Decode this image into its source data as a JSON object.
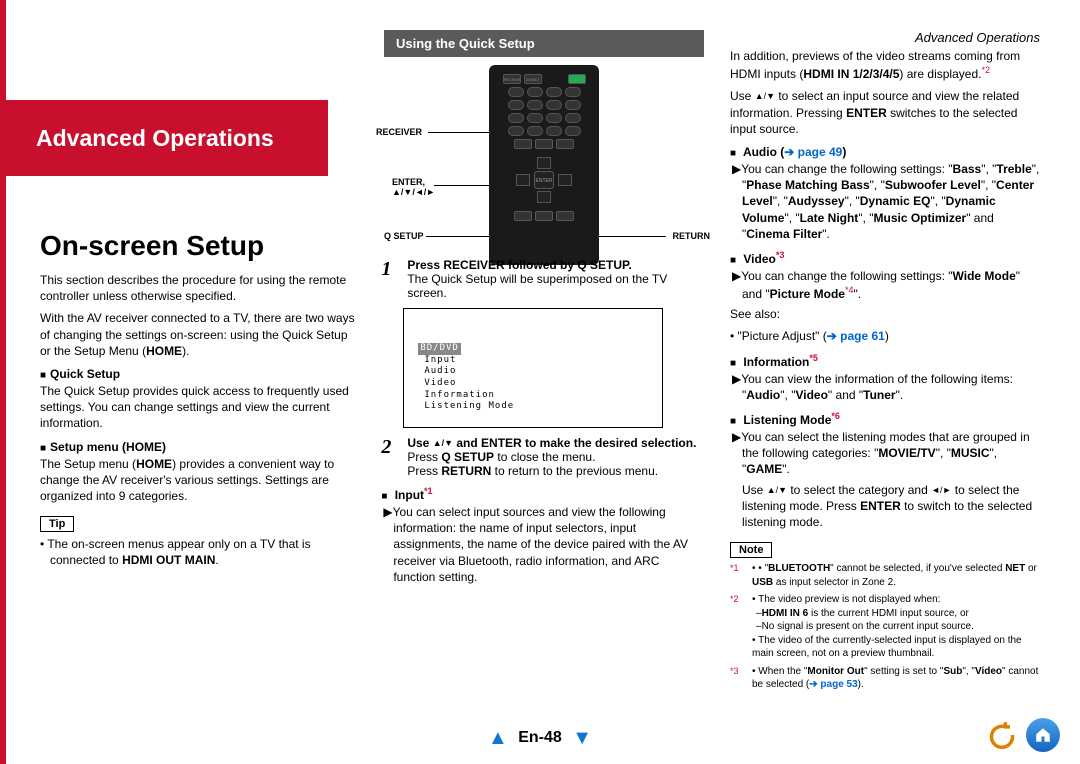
{
  "headerRight": "Advanced Operations",
  "redBarTitle": "Advanced Operations",
  "col1": {
    "title": "On-screen Setup",
    "intro1": "This section describes the procedure for using the remote controller unless otherwise specified.",
    "intro2": "With the AV receiver connected to a TV, there are two ways of changing the settings on-screen: using the Quick Setup or the Setup Menu (",
    "intro2home": "HOME",
    "intro2end": ").",
    "qsHead": "Quick Setup",
    "qsText": "The Quick Setup provides quick access to frequently used settings. You can change settings and view the current information.",
    "smHead": "Setup menu (HOME)",
    "smText1": "The Setup menu (",
    "smHome": "HOME",
    "smText2": ") provides a convenient way to change the AV receiver's various settings. Settings are organized into 9 categories.",
    "tipLabel": "Tip",
    "tip1a": "The on-screen menus appear only on a TV that is connected to ",
    "tip1b": "HDMI OUT MAIN",
    "tip1c": "."
  },
  "col2": {
    "barTitle": "Using the Quick Setup",
    "labels": {
      "receiver": "RECEIVER",
      "enter": "ENTER,",
      "arrows": "▲/▼/◄/►",
      "qsetup": "Q SETUP",
      "return": "RETURN"
    },
    "step1Head": "Press RECEIVER followed by Q SETUP.",
    "step1Body": "The Quick Setup will be superimposed on the TV screen.",
    "osd": {
      "title": "BD/DVD",
      "items": [
        "Input",
        "Audio",
        "Video",
        "Information",
        "Listening Mode"
      ]
    },
    "step2Head1": "Use ",
    "step2Head2": " and ENTER to make the desired selection.",
    "udSymbol": "▲/▼",
    "step2l1a": "Press ",
    "step2l1b": "Q SETUP",
    "step2l1c": " to close the menu.",
    "step2l2a": "Press ",
    "step2l2b": "RETURN",
    "step2l2c": " to return to the previous menu.",
    "inputHead": "Input",
    "inputSup": "*1",
    "inputBody": "You can select input sources and view the following information: the name of input selectors, input assignments, the name of the device paired with the AV receiver via Bluetooth, radio information, and ARC function setting."
  },
  "col3": {
    "topPara1a": "In addition, previews of the video streams coming from HDMI inputs (",
    "topPara1b": "HDMI IN 1/2/3/4/5",
    "topPara1c": ") are displayed.",
    "topSup": "*2",
    "topPara2a": "Use ",
    "topPara2b": " to select an input source and view the related information. Pressing ",
    "topPara2c": "ENTER",
    "topPara2d": " switches to the selected input source.",
    "audioHead": "Audio (",
    "audioLink": "➔ page 49",
    "audioHeadEnd": ")",
    "audioBody1": "You can change the following settings: \"",
    "audioBass": "Bass",
    "audioTre": "Treble",
    "audioPMB": "Phase Matching Bass",
    "audioSub": "Subwoofer Level",
    "audioCen": "Center Level",
    "audioAud": "Audyssey",
    "audioDEQ": "Dynamic EQ",
    "audioDV": "Dynamic Volume",
    "audioLN": "Late Night",
    "audioMO": "Music Optimizer",
    "audioCF": "Cinema Filter",
    "videoHead": "Video",
    "videoSup": "*3",
    "videoBody1": "You can change the following settings: \"",
    "videoWM": "Wide Mode",
    "videoPM": "Picture Mode",
    "videoPMSup": "*4",
    "seeAlso": "See also:",
    "seeAlsoItem": "\"Picture Adjust\" (",
    "seeAlsoLink": "➔ page 61",
    "seeAlsoEnd": ")",
    "infoHead": "Information",
    "infoSup": "*5",
    "infoBody1": "You can view the information of the following items: \"",
    "infoAud": "Audio",
    "infoVid": "Video",
    "infoTun": "Tuner",
    "lmHead": "Listening Mode",
    "lmSup": "*6",
    "lmBody1": "You can select the listening modes that are grouped in the following categories: \"",
    "lmMT": "MOVIE/TV",
    "lmMU": "MUSIC",
    "lmGA": "GAME",
    "lmUse1": "Use ",
    "lmUse2": " to select the category and ",
    "lmUse3": " to select the listening mode. Press ",
    "lmEnter": "ENTER",
    "lmUse4": " to switch to the selected listening mode.",
    "lrSymbol": "◄/►",
    "noteLabel": "Note",
    "n1a": "\"",
    "n1b": "BLUETOOTH",
    "n1c": "\" cannot be selected, if you've selected ",
    "n1d": "NET",
    "n1e": " or ",
    "n1f": "USB",
    "n1g": " as input selector in Zone 2.",
    "n2a": "The video preview is not displayed when:",
    "n2b1": "HDMI IN 6",
    "n2b2": " is the current HDMI input source, or",
    "n2c": "No signal is present on the current input source.",
    "n2d": "The video of the currently-selected input is displayed on the main screen, not on a preview thumbnail.",
    "n3a": "When the \"",
    "n3b": "Monitor Out",
    "n3c": "\" setting is set to \"",
    "n3d": "Sub",
    "n3e": "\", \"",
    "n3f": "Video",
    "n3g": "\" cannot be selected (",
    "n3link": "➔ page 53",
    "n3end": ")."
  },
  "pageNum": "En-48"
}
